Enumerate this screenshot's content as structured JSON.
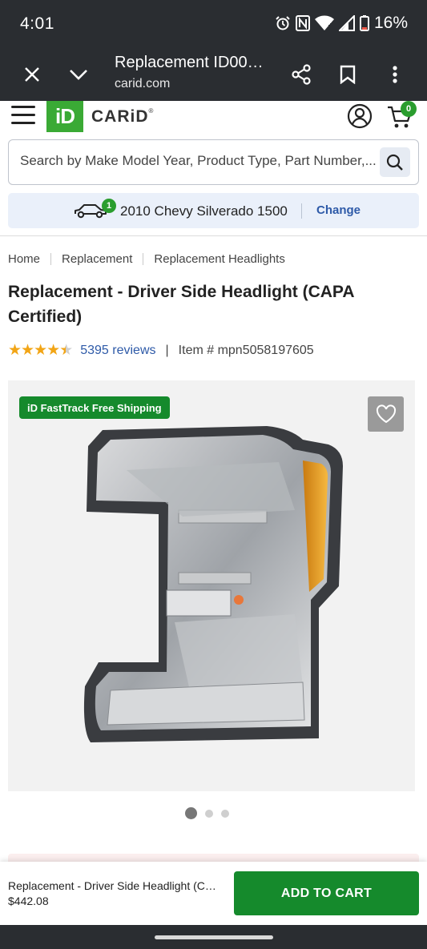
{
  "status_bar": {
    "time": "4:01",
    "battery": "16%",
    "icons": [
      "alarm-icon",
      "nfc-icon",
      "wifi-icon",
      "signal-icon",
      "battery-icon"
    ]
  },
  "browser": {
    "page_title": "Replacement ID00…",
    "url": "carid.com",
    "icons": [
      "close-icon",
      "chevron-down-icon",
      "share-icon",
      "bookmark-icon",
      "more-vertical-icon"
    ]
  },
  "header": {
    "logo_mark": "iD",
    "logo_text": "CARiD",
    "logo_reg": "®",
    "cart_count": "0",
    "icons": [
      "hamburger-menu-icon",
      "account-icon",
      "cart-icon"
    ]
  },
  "search": {
    "placeholder": "Search by Make Model Year, Product Type, Part Number,..."
  },
  "vehicle": {
    "badge": "1",
    "name": "2010 Chevy Silverado 1500",
    "change_label": "Change"
  },
  "breadcrumb": [
    "Home",
    "Replacement",
    "Replacement Headlights"
  ],
  "product": {
    "title": "Replacement - Driver Side Headlight (CAPA Certified)",
    "rating": 4.5,
    "stars": "★★★★★",
    "reviews": "5395 reviews",
    "rating_separator": "|",
    "item_number": "Item # mpn5058197605",
    "shipping_badge": "iD FastTrack Free Shipping",
    "gallery_total": 3,
    "gallery_active": 1
  },
  "sticky_bar": {
    "name": "Replacement - Driver Side Headlight (C…",
    "price": "$442.08",
    "add_to_cart": "ADD TO CART"
  },
  "colors": {
    "brand_green": "#3aaa35",
    "button_green": "#158a2c",
    "link_blue": "#2e5aa8",
    "star": "#f2a516",
    "dark_bar": "#2a2d31"
  }
}
